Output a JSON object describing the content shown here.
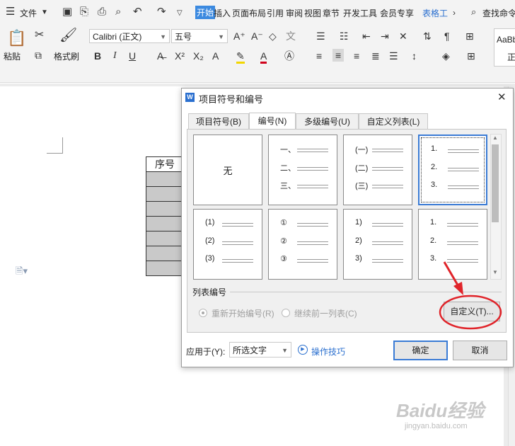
{
  "ribbon": {
    "menu_label": "文件",
    "tabs": [
      "开始",
      "插入",
      "页面布局",
      "引用",
      "审阅",
      "视图",
      "章节",
      "开发工具",
      "会员专享",
      "表格工"
    ],
    "active_tab": "开始",
    "search_label": "查找命令",
    "paste_label": "粘贴",
    "format_painter_label": "格式刷",
    "font_name": "Calibri (正文)",
    "font_size": "五号",
    "style_preview": "AaBb",
    "style_name": "正"
  },
  "document": {
    "table_header": "序号",
    "row_count": 7
  },
  "dialog": {
    "title": "项目符号和编号",
    "close": "✕",
    "tabs": [
      "项目符号(B)",
      "编号(N)",
      "多级编号(U)",
      "自定义列表(L)"
    ],
    "active_tab": "编号(N)",
    "grid": [
      {
        "type": "none",
        "label": "无"
      },
      {
        "type": "list",
        "markers": [
          "一、",
          "二、",
          "三、"
        ]
      },
      {
        "type": "list",
        "markers": [
          "(一)",
          "(二)",
          "(三)"
        ]
      },
      {
        "type": "list",
        "markers": [
          "1.",
          "2.",
          "3."
        ],
        "selected": true
      },
      {
        "type": "list",
        "markers": [
          "(1)",
          "(2)",
          "(3)"
        ]
      },
      {
        "type": "list",
        "markers": [
          "①",
          "②",
          "③"
        ]
      },
      {
        "type": "list",
        "markers": [
          "1)",
          "2)",
          "3)"
        ]
      },
      {
        "type": "list",
        "markers": [
          "1.",
          "2.",
          "3."
        ]
      }
    ],
    "list_numbering_label": "列表编号",
    "restart_label": "重新开始编号(R)",
    "continue_label": "继续前一列表(C)",
    "customize_label": "自定义(T)...",
    "apply_to_label": "应用于(Y):",
    "apply_to_value": "所选文字",
    "tips_label": "操作技巧",
    "ok_label": "确定",
    "cancel_label": "取消"
  },
  "watermark": {
    "brand": "Baidu经验",
    "url": "jingyan.baidu.com"
  },
  "colors": {
    "accent": "#3a7bd5",
    "annotation": "#e0242a",
    "active_tab_bg": "#3c8ae0"
  }
}
